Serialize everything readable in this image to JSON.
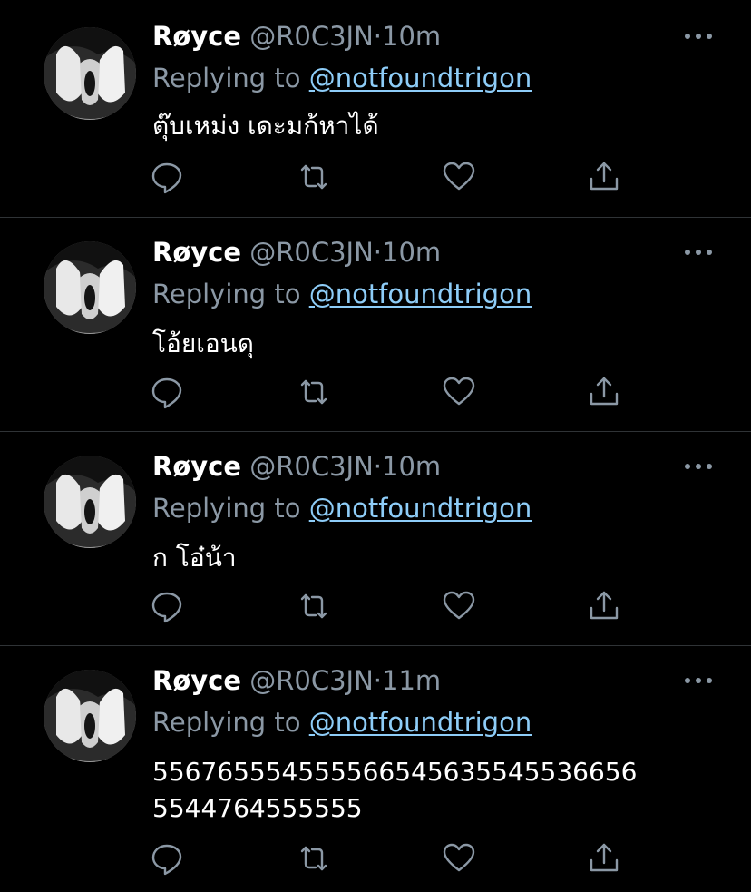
{
  "theme": {
    "background": "#000000",
    "divider": "#2f3336",
    "secondary_text": "#8b98a5",
    "mention_color": "#8ecdf8",
    "icon_color": "#8b98a5"
  },
  "tweets": [
    {
      "display_name": "Røyce",
      "handle": "@R0C3JN",
      "separator": "·",
      "time": "10m",
      "reply_prefix": "Replying to",
      "reply_to": "@notfoundtrigon",
      "text_lines": [
        "ตุ๊บเหม่ง เดะมก้หาได้"
      ],
      "icons": [
        "reply-icon",
        "retweet-icon",
        "like-icon",
        "share-icon",
        "more-icon"
      ]
    },
    {
      "display_name": "Røyce",
      "handle": "@R0C3JN",
      "separator": "·",
      "time": "10m",
      "reply_prefix": "Replying to",
      "reply_to": "@notfoundtrigon",
      "text_lines": [
        "โอ้ยเอนดุ"
      ],
      "icons": [
        "reply-icon",
        "retweet-icon",
        "like-icon",
        "share-icon",
        "more-icon"
      ]
    },
    {
      "display_name": "Røyce",
      "handle": "@R0C3JN",
      "separator": "·",
      "time": "10m",
      "reply_prefix": "Replying to",
      "reply_to": "@notfoundtrigon",
      "text_lines": [
        "ก โอ๋น้า"
      ],
      "icons": [
        "reply-icon",
        "retweet-icon",
        "like-icon",
        "share-icon",
        "more-icon"
      ]
    },
    {
      "display_name": "Røyce",
      "handle": "@R0C3JN",
      "separator": "·",
      "time": "11m",
      "reply_prefix": "Replying to",
      "reply_to": "@notfoundtrigon",
      "text_lines": [
        "55676555455556654563554553665​6",
        "5544764555555"
      ],
      "icons": [
        "reply-icon",
        "retweet-icon",
        "like-icon",
        "share-icon",
        "more-icon"
      ]
    }
  ]
}
